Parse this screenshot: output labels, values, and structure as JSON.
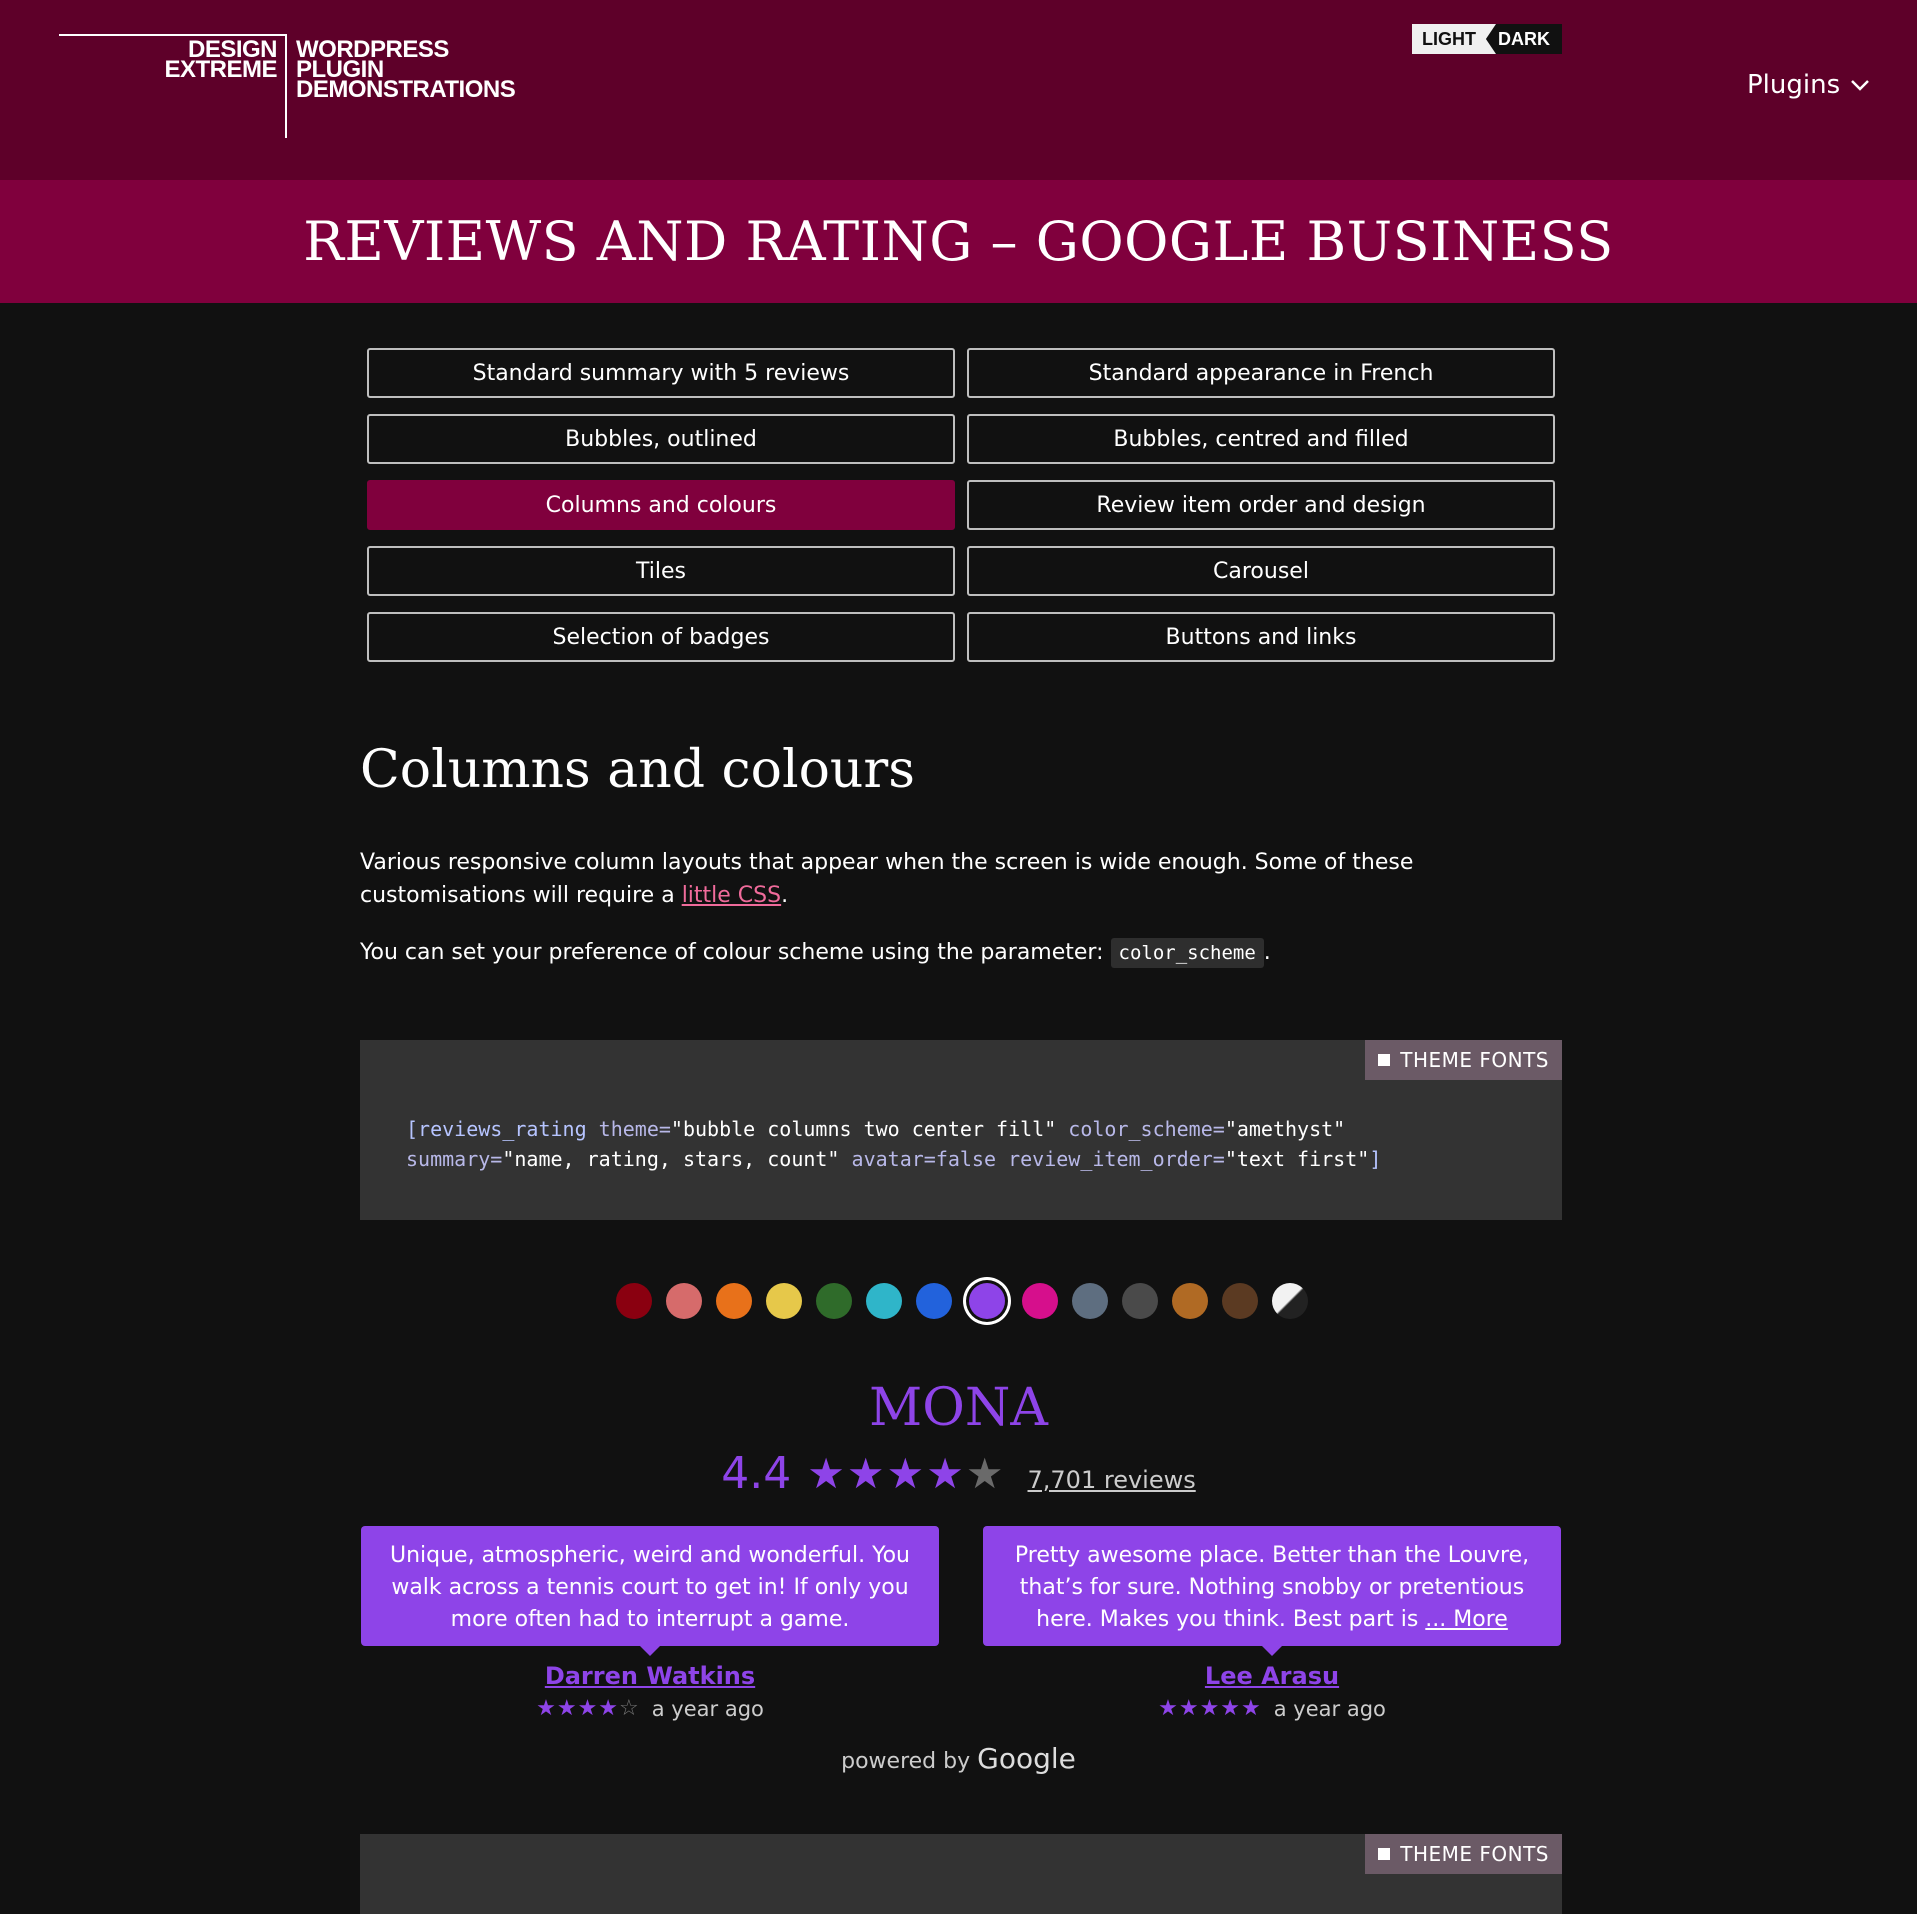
{
  "logo": {
    "left_lines": [
      "DESIGN",
      "EXTREME"
    ],
    "right_lines": [
      "WORDPRESS",
      "PLUGIN",
      "DEMONSTRATIONS"
    ]
  },
  "theme_toggle": {
    "light": "LIGHT",
    "dark": "DARK"
  },
  "menu": {
    "plugins": "Plugins"
  },
  "page": {
    "title": "REVIEWS AND RATING – GOOGLE BUSINESS"
  },
  "nav": [
    "Standard summary with 5 reviews",
    "Standard appearance in French",
    "Bubbles, outlined",
    "Bubbles, centred and filled",
    "Columns and colours",
    "Review item order and design",
    "Tiles",
    "Carousel",
    "Selection of badges",
    "Buttons and links"
  ],
  "nav_active": "Columns and colours",
  "section": {
    "heading": "Columns and colours",
    "p1_text": "Various responsive column layouts that appear when the screen is wide enough. Some of these customisations will require a ",
    "p1_link": "little CSS",
    "p1_end": ".",
    "p2_text": "You can set your preference of colour scheme using the parameter: ",
    "p2_code": "color_scheme",
    "p2_end": "."
  },
  "code_block": {
    "badge": "THEME FONTS",
    "line1": {
      "open": "[reviews_rating",
      "a1": " theme=",
      "v1": "\"bubble columns two center fill\"",
      "a2": " color_scheme=",
      "v2": "\"amethyst\""
    },
    "line2": {
      "a1": "summary=",
      "v1": "\"name, rating, stars, count\"",
      "a2": " avatar=",
      "v2": "false",
      "a3": " review_item_order=",
      "v3": "\"text first\"",
      "close": "]"
    }
  },
  "code_block_2": {
    "badge": "THEME FONTS"
  },
  "colors": {
    "header": "#5e0029",
    "title_band": "#80003d",
    "accent": "#8e44e8",
    "swatches": [
      "#8a0010",
      "#d66b6b",
      "#e8711a",
      "#e6c84a",
      "#2f6b2a",
      "#2fb5c9",
      "#2262dc",
      "#8e44e8",
      "#d60f8c",
      "#5e6e80",
      "#4a4a4a",
      "#b06a24",
      "#5b3a22",
      "split-black-white"
    ],
    "selected_swatch": "#8e44e8"
  },
  "business": {
    "name": "MONA",
    "rating": "4.4",
    "stars_value": 4.4,
    "reviews_count": "7,701 reviews"
  },
  "reviews": [
    {
      "text": "Unique, atmospheric, weird and wonderful. You walk across a tennis court to get in! If only you more often had to interrupt a game.",
      "more": "",
      "author": "Darren Watkins",
      "stars": 4,
      "ago": "a year ago"
    },
    {
      "text": "Pretty awesome place. Better than the Louvre, that’s for sure. Nothing snobby or pretentious here. Makes you think. Best part is ",
      "more": "... More",
      "author": "Lee Arasu",
      "stars": 5,
      "ago": "a year ago"
    }
  ],
  "powered": {
    "prefix": "powered by ",
    "brand": "Google"
  }
}
